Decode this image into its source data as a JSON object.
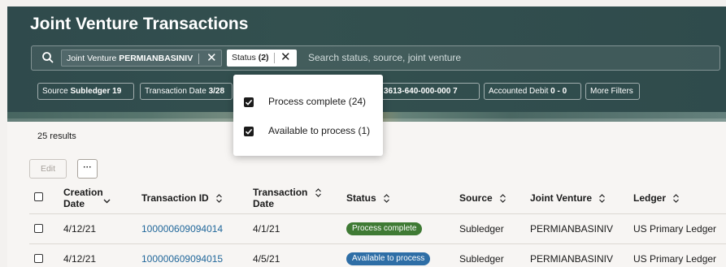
{
  "header": {
    "title": "Joint Venture Transactions",
    "chips": {
      "jv_prefix": "Joint Venture",
      "jv_value": "PERMIANBASINIV",
      "status_label": "Status",
      "status_count": "(2)"
    },
    "search_placeholder": "Search status, source, joint venture",
    "filters": {
      "source_prefix": "Source",
      "source_value": "Subledger",
      "source_count": "19",
      "date_prefix": "Transaction Date",
      "date_value": "3/28",
      "account_value": "3613-640-000-000",
      "account_count": "7",
      "debit_prefix": "Accounted Debit",
      "debit_value": "0 - 0",
      "more": "More Filters"
    }
  },
  "status_dropdown": {
    "options": [
      {
        "label": "Process complete (24)",
        "checked": true
      },
      {
        "label": "Available to process (1)",
        "checked": true
      }
    ]
  },
  "results_text": "25 results",
  "toolbar": {
    "edit_label": "Edit",
    "more_label": "···"
  },
  "table": {
    "columns": {
      "creation_date_1": "Creation",
      "creation_date_2": "Date",
      "transaction_id": "Transaction ID",
      "transaction_date_1": "Transaction",
      "transaction_date_2": "Date",
      "status": "Status",
      "source": "Source",
      "joint_venture": "Joint Venture",
      "ledger": "Ledger"
    },
    "rows": [
      {
        "creation_date": "4/12/21",
        "transaction_id": "100000609094014",
        "transaction_date": "4/1/21",
        "status": "Process complete",
        "status_color": "#3f7a34",
        "source": "Subledger",
        "joint_venture": "PERMIANBASINIV",
        "ledger": "US Primary Ledger"
      },
      {
        "creation_date": "4/12/21",
        "transaction_id": "100000609094015",
        "transaction_date": "4/5/21",
        "status": "Available to process",
        "status_color": "#2e6ea6",
        "source": "Subledger",
        "joint_venture": "PERMIANBASINIV",
        "ledger": "US Primary Ledger"
      }
    ]
  },
  "colors": {
    "header_bg": "#2f4a4c",
    "link": "#22689b",
    "complete": "#3f7a34",
    "available": "#2e6ea6"
  }
}
